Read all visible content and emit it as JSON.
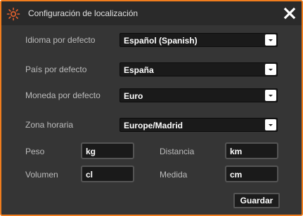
{
  "window": {
    "title": "Configuración de localización",
    "close_icon": "close-icon",
    "app_icon": "settings-sun-icon",
    "accent_color": "#f07d1e"
  },
  "settings": {
    "language": {
      "label": "Idioma por defecto",
      "value": "Español (Spanish)"
    },
    "country": {
      "label": "País por defecto",
      "value": "España"
    },
    "currency": {
      "label": "Moneda por defecto",
      "value": "Euro"
    },
    "timezone": {
      "label": "Zona horaria",
      "value": "Europe/Madrid"
    }
  },
  "units": {
    "weight": {
      "label": "Peso",
      "value": "kg"
    },
    "distance": {
      "label": "Distancia",
      "value": "km"
    },
    "volume": {
      "label": "Volumen",
      "value": "cl"
    },
    "measure": {
      "label": "Medida",
      "value": "cm"
    }
  },
  "actions": {
    "save_label": "Guardar"
  }
}
